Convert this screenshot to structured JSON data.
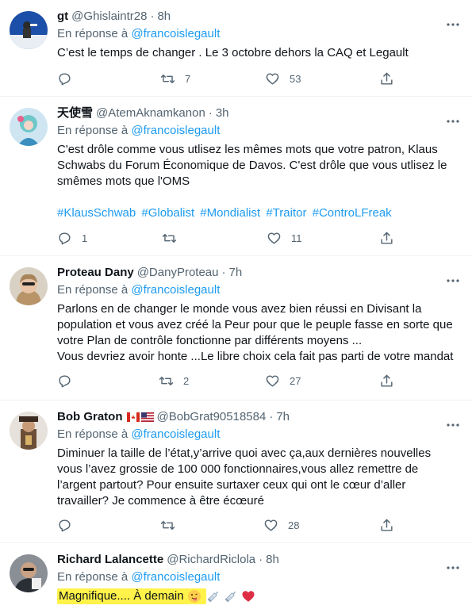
{
  "reply_prefix": "En réponse à",
  "tweets": [
    {
      "name": "gt",
      "handle": "@Ghislaintr28",
      "time": "8h",
      "reply_to": "@francoislegault",
      "lines": [
        "C’est le temps de changer . Le 3 octobre dehors la CAQ et Legault"
      ],
      "retweets": "7",
      "likes": "53"
    },
    {
      "name": "天使雪",
      "handle": "@AtemAknamkanon",
      "time": "3h",
      "reply_to": "@francoislegault",
      "lines": [
        "C'est drôle comme vous utlisez les mêmes mots que votre patron, Klaus",
        "Schwabs du Forum Économique de Davos. C'est drôle que vous utlisez le",
        "smêmes mots que l'OMS"
      ],
      "hashtags": [
        "#KlausSchwab",
        "#Globalist",
        "#Mondialist",
        "#Traitor",
        "#ControLFreak"
      ],
      "replies": "1",
      "likes": "11"
    },
    {
      "name": "Proteau Dany",
      "handle": "@DanyProteau",
      "time": "7h",
      "reply_to": "@francoislegault",
      "lines": [
        "Parlons en de changer le monde vous avez bien réussi en Divisant la",
        "population et vous avez créé la Peur pour que le peuple fasse en sorte que",
        "votre Plan de contrôle fonctionne par différents moyens ...",
        "Vous devriez avoir honte ...Le libre choix cela fait pas parti de votre mandat"
      ],
      "retweets": "2",
      "likes": "27"
    },
    {
      "name": "Bob Graton",
      "handle": "@BobGrat90518584",
      "time": "7h",
      "reply_to": "@francoislegault",
      "lines": [
        "Diminuer la taille de l’état,y’arrive quoi avec ça,aux dernières nouvelles",
        "vous l’avez grossie de 100 000 fonctionnaires,vous allez remettre de",
        "l’argent partout? Pour ensuite surtaxer ceux qui ont le cœur d’aller",
        "travailler? Je commence à être écœuré"
      ],
      "likes": "28"
    },
    {
      "name": "Richard Lalancette",
      "handle": "@RichardRiclola",
      "time": "8h",
      "reply_to": "@francoislegault",
      "highlighted_text": "Magnifique.... À demain",
      "emojis": [
        "face-with-tongue-emoji",
        "syringe-emoji",
        "syringe-emoji",
        "red-heart-emoji"
      ],
      "highlight_color": "#fff24a"
    }
  ],
  "colors": {
    "link": "#1d9bf0",
    "muted": "#536471",
    "text": "#0f1419",
    "like_heart": "#f4245e"
  }
}
